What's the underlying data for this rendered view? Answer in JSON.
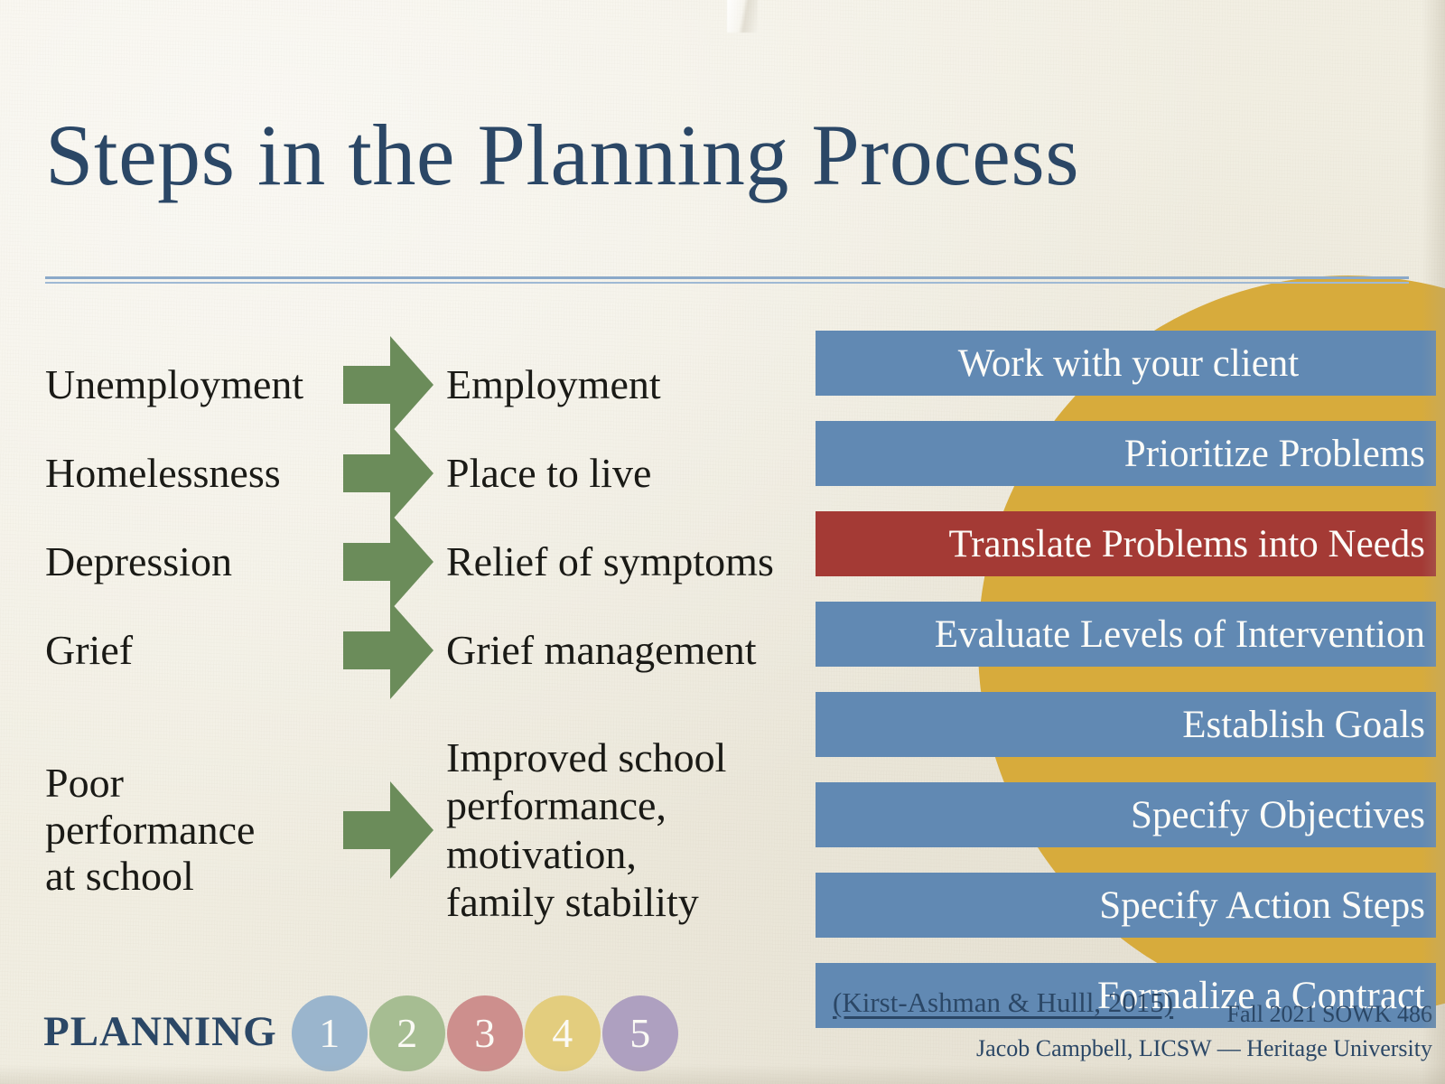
{
  "slide": {
    "title": "Steps in the Planning Process",
    "background_color": "#f2efe4",
    "title_color": "#2b4766",
    "accent_circle_color": "#d7ab3c",
    "rule_color": "#8ba9c9"
  },
  "flow": {
    "arrow_color": "#6b8c5a",
    "rows": [
      {
        "from": "Unemployment",
        "to": "Employment"
      },
      {
        "from": "Homelessness",
        "to": "Place to live"
      },
      {
        "from": "Depression",
        "to": "Relief of symptoms"
      },
      {
        "from": "Grief",
        "to": "Grief management"
      },
      {
        "from": "Poor\nperformance\nat school",
        "to": "Improved school\nperformance,\nmotivation,\nfamily stability"
      }
    ]
  },
  "steps": {
    "bar_color_default": "#6189b3",
    "bar_color_highlight": "#a43a35",
    "items": [
      {
        "label": "Work with your client",
        "highlight": false
      },
      {
        "label": "Prioritize Problems",
        "highlight": false
      },
      {
        "label": "Translate Problems into Needs",
        "highlight": true
      },
      {
        "label": "Evaluate Levels of Intervention",
        "highlight": false
      },
      {
        "label": "Establish Goals",
        "highlight": false
      },
      {
        "label": "Specify Objectives",
        "highlight": false
      },
      {
        "label": "Specify Action Steps",
        "highlight": false
      },
      {
        "label": "Formalize a Contract",
        "highlight": false
      }
    ]
  },
  "footer": {
    "citation": "(Kirst-Ashman & Hulll, 2015)",
    "course": "Fall 2021 SOWK 486",
    "instructor": "Jacob Campbell, LICSW — Heritage University",
    "planning_label": "PLANNING",
    "dots": [
      {
        "number": "1",
        "color": "#9ab5cd"
      },
      {
        "number": "2",
        "color": "#a6bd92"
      },
      {
        "number": "3",
        "color": "#cd8f8d"
      },
      {
        "number": "4",
        "color": "#e3cd7e"
      },
      {
        "number": "5",
        "color": "#aea0c0"
      }
    ]
  }
}
